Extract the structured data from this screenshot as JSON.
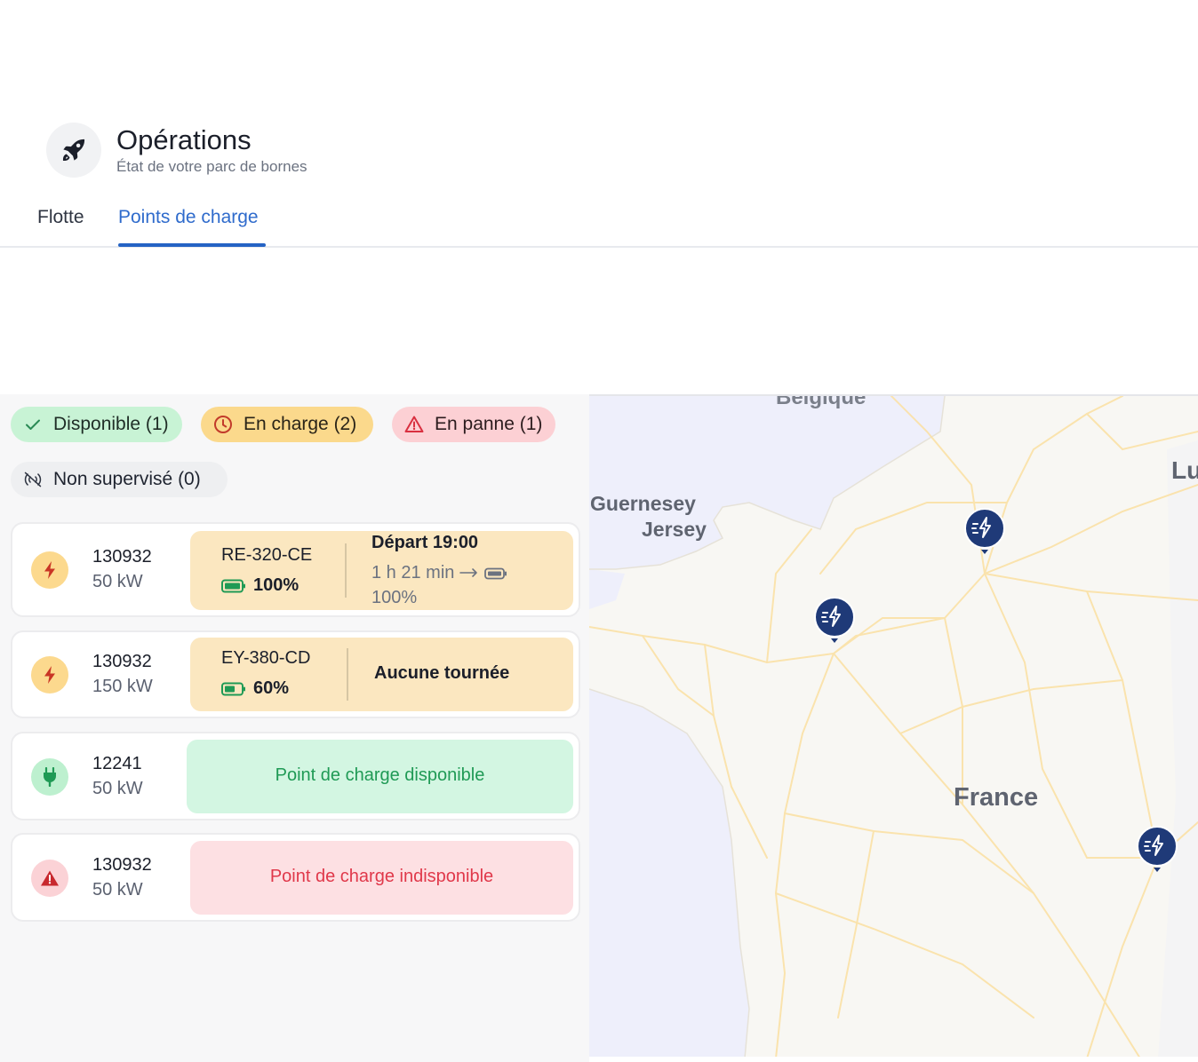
{
  "header": {
    "title": "Opérations",
    "subtitle": "État de votre parc de bornes",
    "icon": "rocket-icon"
  },
  "tabs": [
    {
      "label": "Flotte",
      "active": false
    },
    {
      "label": "Points de charge",
      "active": true
    }
  ],
  "filters": {
    "disponible": "Disponible (1)",
    "en_charge": "En charge (2)",
    "en_panne": "En panne (1)",
    "non_supervise": "Non supervisé (0)"
  },
  "charge_points": [
    {
      "id": "130932",
      "power": "50 kW",
      "status": "charging",
      "plate": "RE-320-CE",
      "battery": "100%",
      "departure": "Départ 19:00",
      "duration": "1 h 21 min",
      "target": "100%"
    },
    {
      "id": "130932",
      "power": "150 kW",
      "status": "charging",
      "plate": "EY-380-CD",
      "battery": "60%",
      "tour": "Aucune tournée"
    },
    {
      "id": "12241",
      "power": "50 kW",
      "status": "available",
      "message": "Point de charge disponible"
    },
    {
      "id": "130932",
      "power": "50 kW",
      "status": "faulted",
      "message": "Point de charge indisponible"
    }
  ],
  "map": {
    "labels": {
      "guernesey": "Guernesey",
      "jersey": "Jersey",
      "france": "France",
      "belgique": "Belgique",
      "lu": "Lu"
    }
  },
  "colors": {
    "accent": "#2563c4",
    "available": "#1f9a55",
    "unavailable": "#e0384a",
    "charging": "#fbd98c",
    "marker": "#1f3a78"
  }
}
